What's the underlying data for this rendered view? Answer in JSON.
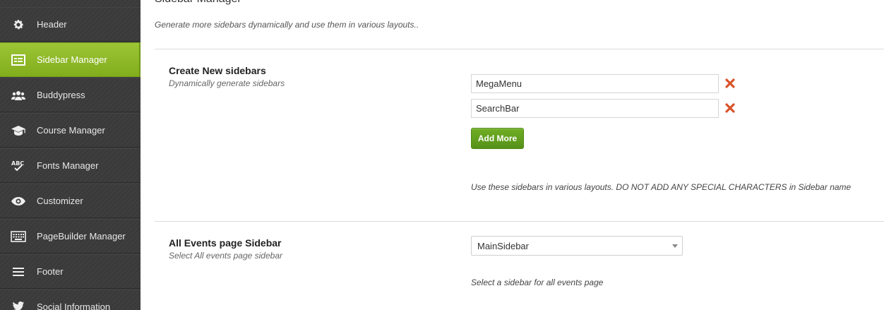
{
  "sidebar": {
    "items": [
      {
        "label": "Header",
        "icon": "gear-icon"
      },
      {
        "label": "Sidebar Manager",
        "icon": "sidebar-list-icon",
        "active": true
      },
      {
        "label": "Buddypress",
        "icon": "users-group-icon"
      },
      {
        "label": "Course Manager",
        "icon": "graduation-cap-icon"
      },
      {
        "label": "Fonts Manager",
        "icon": "spellcheck-icon"
      },
      {
        "label": "Customizer",
        "icon": "eye-icon"
      },
      {
        "label": "PageBuilder Manager",
        "icon": "keyboard-icon"
      },
      {
        "label": "Footer",
        "icon": "footer-icon"
      },
      {
        "label": "Social Information",
        "icon": "twitter-icon"
      }
    ],
    "active_color": "#8dba28"
  },
  "main": {
    "title": "Sidebar Manager",
    "description": "Generate more sidebars dynamically and use them in various layouts..",
    "create_section": {
      "title": "Create New sidebars",
      "subtitle": "Dynamically generate sidebars",
      "sidebars": [
        {
          "value": "MegaMenu"
        },
        {
          "value": "SearchBar"
        }
      ],
      "add_button_label": "Add More",
      "help_text": "Use these sidebars in various layouts. DO NOT ADD ANY SPECIAL CHARACTERS in Sidebar name"
    },
    "events_section": {
      "title": "All Events page Sidebar",
      "subtitle": "Select All events page sidebar",
      "selected": "MainSidebar",
      "help_text": "Select a sidebar for all events page"
    }
  },
  "colors": {
    "add_button": "#62a01e",
    "remove_icon": "#d9542a",
    "sidebar_bg": "#3a3a3a"
  }
}
